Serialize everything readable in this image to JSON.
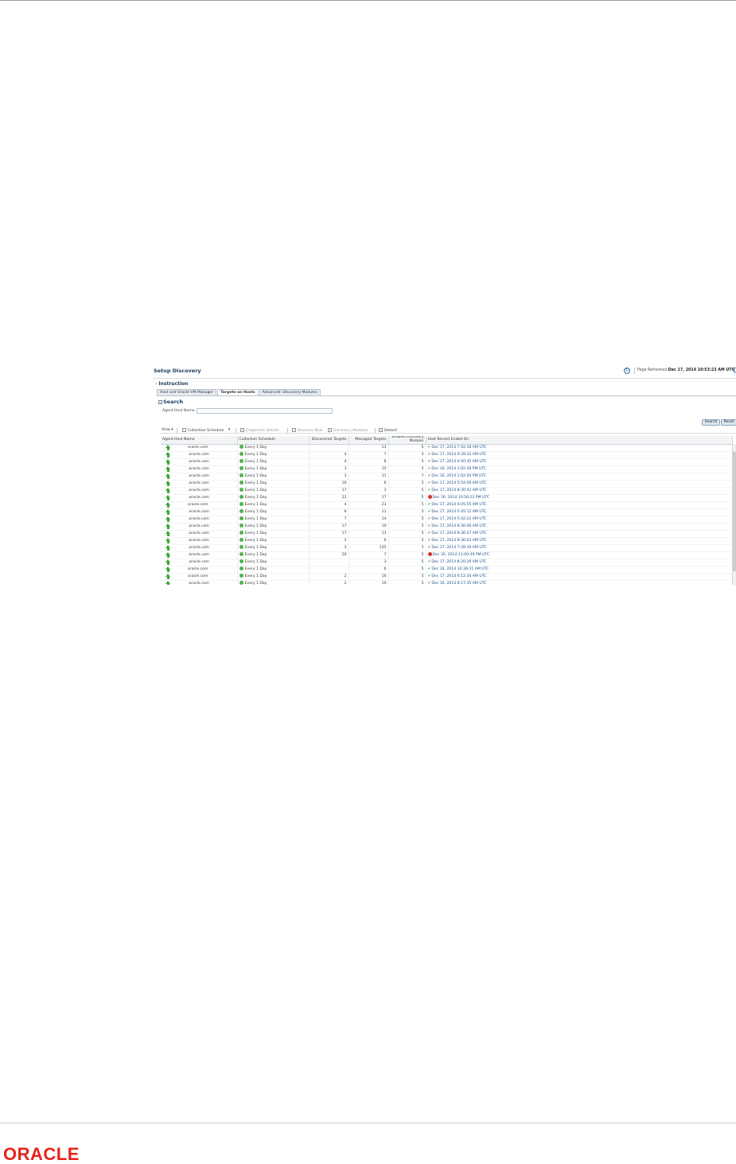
{
  "logo": "ORACLE",
  "header": {
    "title": "Setup Discovery",
    "refresh_label": "Page Refreshed",
    "refresh_time": "Dec 17, 2014 10:53:23 AM UTC",
    "refresh_icon": "refresh-icon",
    "edge_icon": "help-icon"
  },
  "instruction": "Instruction",
  "tabs": [
    "Host and Oracle VM Manager",
    "Targets on Hosts",
    "Advanced: Discovery Modules"
  ],
  "active_tab": 1,
  "search": {
    "title": "Search",
    "field_label": "Agent Host Name",
    "field_value": "",
    "search_button": "Search",
    "reset_button": "Reset"
  },
  "toolbar": {
    "view": "View ▾",
    "collection_schedule": "Collection Schedule",
    "collection_arrow": "▾",
    "diagnostic_details": "Diagnostic Details",
    "discover_now": "Discover Now",
    "discovery_modules": "Discovery Modules",
    "detach": "Detach"
  },
  "columns": [
    "Agent Host Name",
    "Collection Schedule",
    "Discovered Targets",
    "Managed Targets",
    "Enabled Discovery Modules",
    "Host Recent Ended On"
  ],
  "rows": [
    {
      "host": "oracle.com",
      "schedule": "Every 1 Day",
      "discovered": "",
      "managed": "13",
      "modules": "5",
      "status": "ok",
      "ended": "Dec 17, 2014 7:42:18 AM UTC"
    },
    {
      "host": ".oracle.com",
      "schedule": "Every 1 Day",
      "discovered": "4",
      "managed": "7",
      "modules": "5",
      "status": "ok",
      "ended": "Dec 17, 2014 9:28:32 AM UTC"
    },
    {
      "host": ".oracle.com",
      "schedule": "Every 1 Day",
      "discovered": "4",
      "managed": "8",
      "modules": "5",
      "status": "ok",
      "ended": "Dec 17, 2014 6:40:45 AM UTC"
    },
    {
      "host": ".oracle.com",
      "schedule": "Every 1 Day",
      "discovered": "3",
      "managed": "15",
      "modules": "5",
      "status": "ok",
      "ended": "Dec 16, 2014 1:02:28 PM UTC"
    },
    {
      "host": ".oracle.com",
      "schedule": "Every 1 Day",
      "discovered": "3",
      "managed": "11",
      "modules": "7",
      "status": "ok",
      "ended": "Dec 16, 2014 1:02:54 PM UTC"
    },
    {
      "host": ".oracle.com",
      "schedule": "Every 1 Day",
      "discovered": "16",
      "managed": "6",
      "modules": "5",
      "status": "ok",
      "ended": "Dec 17, 2014 5:54:09 AM UTC"
    },
    {
      "host": ".oracle.com",
      "schedule": "Every 1 Day",
      "discovered": "17",
      "managed": "3",
      "modules": "5",
      "status": "ok",
      "ended": "Dec 17, 2014 8:30:42 AM UTC"
    },
    {
      "host": ".oracle.com",
      "schedule": "Every 1 Day",
      "discovered": "22",
      "managed": "17",
      "modules": "5",
      "status": "error",
      "ended": "Dec 16, 2014 10:56:22 PM UTC"
    },
    {
      "host": "oracle.com",
      "schedule": "Every 1 Day",
      "discovered": "4",
      "managed": "23",
      "modules": "5",
      "status": "ok",
      "ended": "Dec 17, 2014 6:05:55 AM UTC"
    },
    {
      "host": ".oracle.com",
      "schedule": "Every 1 Day",
      "discovered": "6",
      "managed": "11",
      "modules": "5",
      "status": "ok",
      "ended": "Dec 17, 2014 5:45:12 AM UTC"
    },
    {
      "host": ".oracle.com",
      "schedule": "Every 1 Day",
      "discovered": "7",
      "managed": "14",
      "modules": "5",
      "status": "ok",
      "ended": "Dec 17, 2014 5:42:22 AM UTC"
    },
    {
      "host": ".oracle.com",
      "schedule": "Every 1 Day",
      "discovered": "17",
      "managed": "10",
      "modules": "5",
      "status": "ok",
      "ended": "Dec 17, 2014 8:36:08 AM UTC"
    },
    {
      "host": ".oracle.com",
      "schedule": "Every 1 Day",
      "discovered": "17",
      "managed": "13",
      "modules": "5",
      "status": "ok",
      "ended": "Dec 17, 2014 8:36:27 AM UTC"
    },
    {
      "host": ".oracle.com",
      "schedule": "Every 1 Day",
      "discovered": "2",
      "managed": "6",
      "modules": "5",
      "status": "ok",
      "ended": "Dec 17, 2014 8:36:02 AM UTC"
    },
    {
      "host": ".oracle.com",
      "schedule": "Every 1 Day",
      "discovered": "3",
      "managed": "135",
      "modules": "5",
      "status": "ok",
      "ended": "Dec 17, 2014 7:39:29 AM UTC"
    },
    {
      "host": ".oracle.com",
      "schedule": "Every 1 Day",
      "discovered": "26",
      "managed": "7",
      "modules": "5",
      "status": "error",
      "ended": "Dec 16, 2014 11:00:49 PM UTC"
    },
    {
      "host": ".oracle.com",
      "schedule": "Every 1 Day",
      "discovered": "",
      "managed": "3",
      "modules": "5",
      "status": "ok",
      "ended": "Dec 17, 2014 8:20:26 AM UTC"
    },
    {
      "host": "oracle.com",
      "schedule": "Every 1 Day",
      "discovered": "",
      "managed": "6",
      "modules": "5",
      "status": "ok",
      "ended": "Dec 16, 2014 10:38:31 AM UTC"
    },
    {
      "host": "oracle.com",
      "schedule": "Every 1 Day",
      "discovered": "2",
      "managed": "16",
      "modules": "5",
      "status": "ok",
      "ended": "Dec 17, 2014 6:12:34 AM UTC"
    },
    {
      "host": ".oracle.com",
      "schedule": "Every 1 Day",
      "discovered": "2",
      "managed": "10",
      "modules": "5",
      "status": "ok",
      "ended": "Dec 16, 2014 8:17:35 AM UTC"
    }
  ]
}
